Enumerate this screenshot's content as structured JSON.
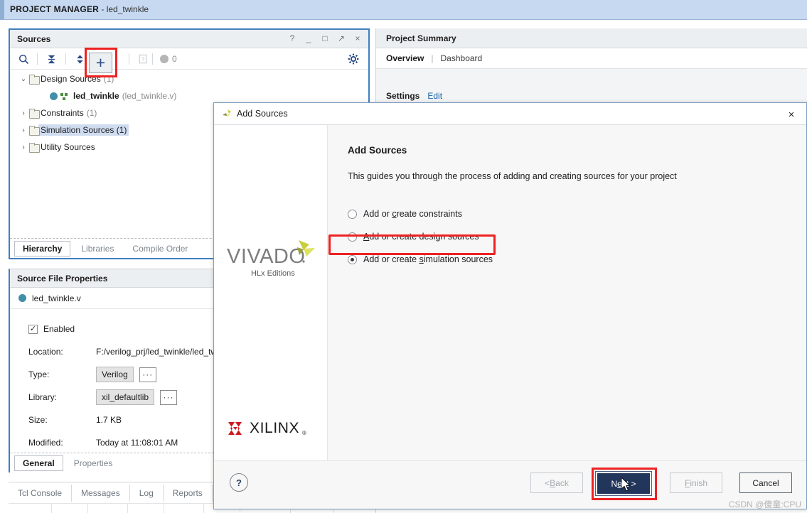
{
  "banner": {
    "title": "PROJECT MANAGER",
    "separator": " - ",
    "project": "led_twinkle"
  },
  "sources_panel": {
    "title": "Sources",
    "window_controls": [
      "?",
      "_",
      "□",
      "↗",
      "×"
    ],
    "toolbar_icons": [
      "search-icon",
      "collapse-all-icon",
      "expand-sort-icon",
      "add-sources-icon",
      "help-icon",
      "status-dot-icon"
    ],
    "status_count": "0",
    "settings_icon": "gear-icon",
    "tree": [
      {
        "label": "Design Sources",
        "count": "(1)",
        "twisty": "⌄",
        "expanded": true,
        "selected": false,
        "indent": 0
      },
      {
        "label": "led_twinkle",
        "file": "(led_twinkle.v)",
        "twisty": "",
        "expanded": false,
        "selected": false,
        "indent": 1
      },
      {
        "label": "Constraints",
        "count": "(1)",
        "twisty": "›",
        "expanded": false,
        "selected": false,
        "indent": 0
      },
      {
        "label": "Simulation Sources",
        "count": "(1)",
        "twisty": "›",
        "expanded": false,
        "selected": true,
        "indent": 0
      },
      {
        "label": "Utility Sources",
        "count": "",
        "twisty": "›",
        "expanded": false,
        "selected": false,
        "indent": 0
      }
    ],
    "tabs": [
      {
        "label": "Hierarchy",
        "active": true
      },
      {
        "label": "Libraries",
        "active": false
      },
      {
        "label": "Compile Order",
        "active": false
      }
    ]
  },
  "properties_panel": {
    "title": "Source File Properties",
    "file_name": "led_twinkle.v",
    "enabled_label": "Enabled",
    "enabled_checked": true,
    "rows": [
      {
        "label": "Location:",
        "value": "F:/verilog_prj/led_twinkle/led_tw",
        "kind": "text"
      },
      {
        "label": "Type:",
        "value": "Verilog",
        "kind": "field"
      },
      {
        "label": "Library:",
        "value": "xil_defaultlib",
        "kind": "field"
      },
      {
        "label": "Size:",
        "value": "1.7 KB",
        "kind": "text"
      },
      {
        "label": "Modified:",
        "value": "Today at 11:08:01 AM",
        "kind": "text"
      }
    ],
    "browse_label": "···",
    "tabs": [
      {
        "label": "General",
        "active": true
      },
      {
        "label": "Properties",
        "active": false
      }
    ]
  },
  "bottom_tabs": [
    {
      "label": "Tcl Console"
    },
    {
      "label": "Messages"
    },
    {
      "label": "Log"
    },
    {
      "label": "Reports"
    }
  ],
  "summary_panel": {
    "title": "Project Summary",
    "overview_label": "Overview",
    "divider": "|",
    "dashboard_label": "Dashboard",
    "settings_label": "Settings",
    "edit_label": "Edit"
  },
  "dialog": {
    "window_title": "Add Sources",
    "close_label": "×",
    "heading": "Add Sources",
    "description": "This guides you through the process of adding and creating sources for your project",
    "vivado_logo_text": "VIVADO",
    "vivado_logo_sub": "HLx Editions",
    "xilinx_logo_text": "XILINX",
    "xilinx_logo_reg": "®",
    "options": [
      {
        "pre": "Add or ",
        "mn": "c",
        "post": "reate constraints",
        "selected": false
      },
      {
        "pre": "",
        "mn": "A",
        "post": "dd or create design sources",
        "selected": false
      },
      {
        "pre": "Add or create ",
        "mn": "s",
        "post": "imulation sources",
        "selected": true
      }
    ],
    "help_label": "?",
    "buttons": [
      {
        "id": "back",
        "pre": "< ",
        "mn": "B",
        "post": "ack",
        "disabled": true
      },
      {
        "id": "next",
        "pre": "N",
        "mn": "e",
        "post": "xt >",
        "disabled": false,
        "primary": true
      },
      {
        "id": "finish",
        "pre": "",
        "mn": "F",
        "post": "inish",
        "disabled": true
      },
      {
        "id": "cancel",
        "pre": "Cancel",
        "mn": "",
        "post": "",
        "disabled": false
      }
    ]
  },
  "watermark": "CSDN @傻童:CPU",
  "colors": {
    "banner_bg": "#c6d9f1",
    "panel_border": "#3f7fbf",
    "highlight_red": "#ee2222",
    "primary_button": "#22365c",
    "link_blue": "#1560ad",
    "selection_blue": "#cfdcf0"
  }
}
